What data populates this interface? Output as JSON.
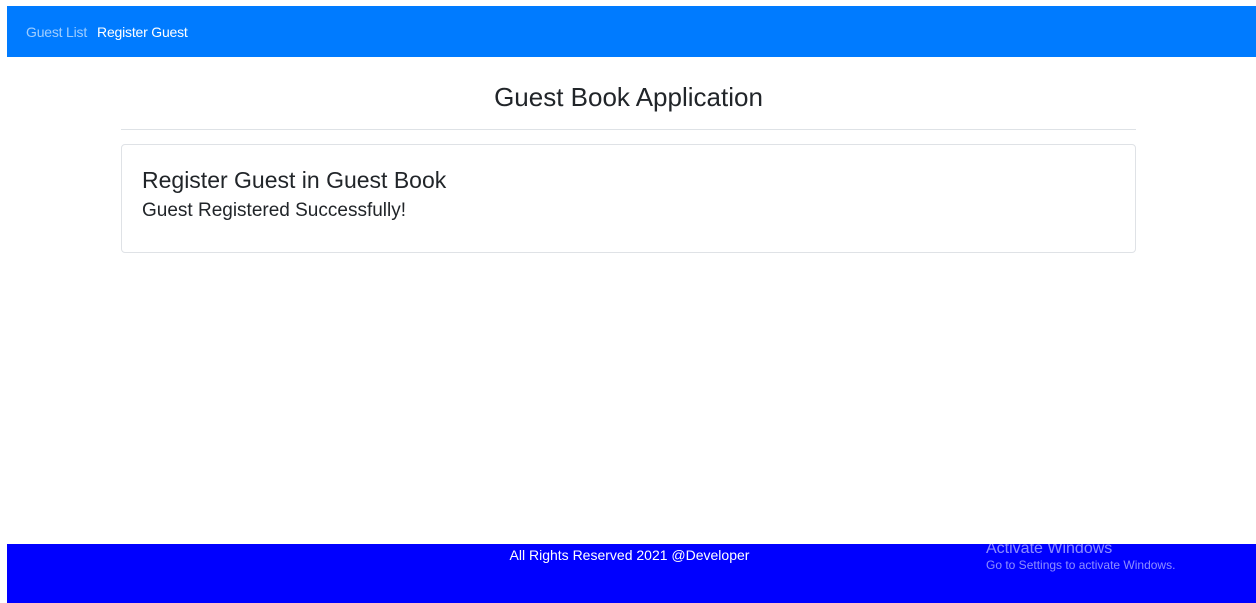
{
  "nav": {
    "links": [
      {
        "label": "Guest List"
      },
      {
        "label": "Register Guest"
      }
    ]
  },
  "page": {
    "title": "Guest Book Application"
  },
  "card": {
    "title": "Register Guest in Guest Book",
    "message": "Guest Registered Successfully!"
  },
  "footer": {
    "text": "All Rights Reserved 2021 @Developer"
  },
  "watermark": {
    "title": "Activate Windows",
    "subtitle": "Go to Settings to activate Windows."
  },
  "colors": {
    "navbar": "#007bff",
    "footer": "#0000ff"
  }
}
